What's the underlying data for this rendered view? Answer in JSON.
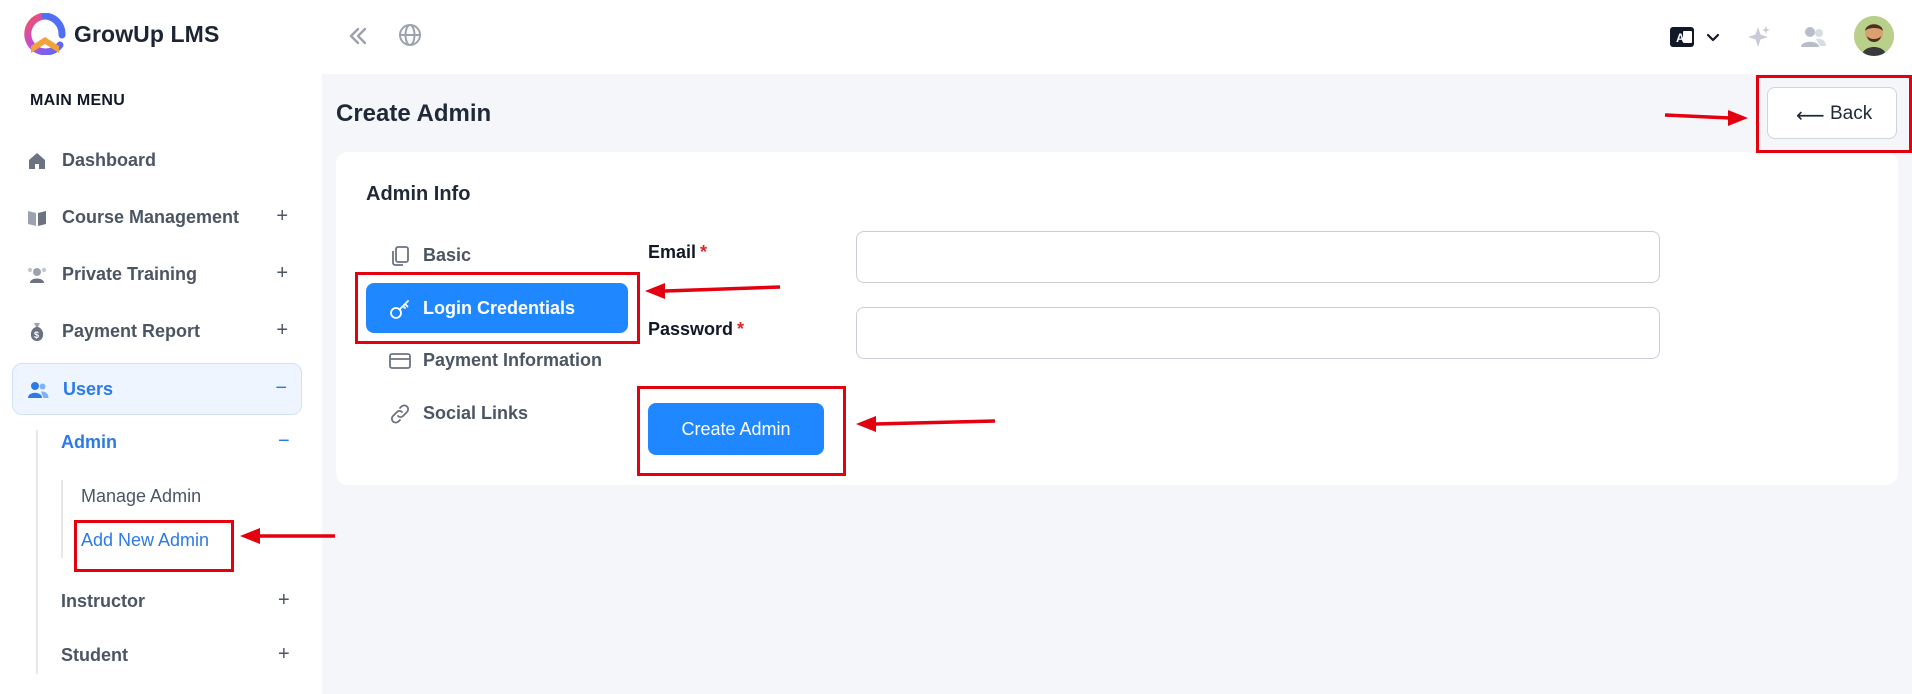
{
  "app": {
    "title": "GrowUp LMS"
  },
  "header": {
    "collapse_icon": "double-chevron-left-icon",
    "globe_icon": "globe-icon",
    "language_icon": "language-switch-icon",
    "sparkle_icon": "sparkle-icon",
    "people_icon": "people-icon",
    "avatar_icon": "user-avatar"
  },
  "sidebar": {
    "heading": "MAIN MENU",
    "items": [
      {
        "label": "Dashboard",
        "icon": "home-icon",
        "sign": ""
      },
      {
        "label": "Course Management",
        "icon": "book-icon",
        "sign": "+"
      },
      {
        "label": "Private Training",
        "icon": "training-icon",
        "sign": "+"
      },
      {
        "label": "Payment Report",
        "icon": "money-bag-icon",
        "sign": "+"
      },
      {
        "label": "Users",
        "icon": "users-icon",
        "sign": "−"
      }
    ],
    "users_sub": [
      {
        "label": "Admin",
        "sign": "−"
      },
      {
        "label": "Instructor",
        "sign": "+"
      },
      {
        "label": "Student",
        "sign": "+"
      }
    ],
    "admin_sub": [
      {
        "label": "Manage Admin"
      },
      {
        "label": "Add New Admin"
      }
    ]
  },
  "main": {
    "page_title": "Create Admin",
    "back_label": "Back",
    "back_arrow": "⟵",
    "card_title": "Admin Info",
    "tabs": [
      {
        "label": "Basic",
        "icon": "copy-icon"
      },
      {
        "label": "Login Credentials",
        "icon": "key-icon"
      },
      {
        "label": "Payment Information",
        "icon": "credit-card-icon"
      },
      {
        "label": "Social Links",
        "icon": "link-icon"
      }
    ],
    "fields": [
      {
        "label": "Email",
        "required": "*",
        "value": ""
      },
      {
        "label": "Password",
        "required": "*",
        "value": ""
      }
    ],
    "submit_label": "Create Admin"
  },
  "colors": {
    "accent": "#1f87ff",
    "sidebar_active": "#2b7ae6",
    "annotation": "#e3000f"
  }
}
